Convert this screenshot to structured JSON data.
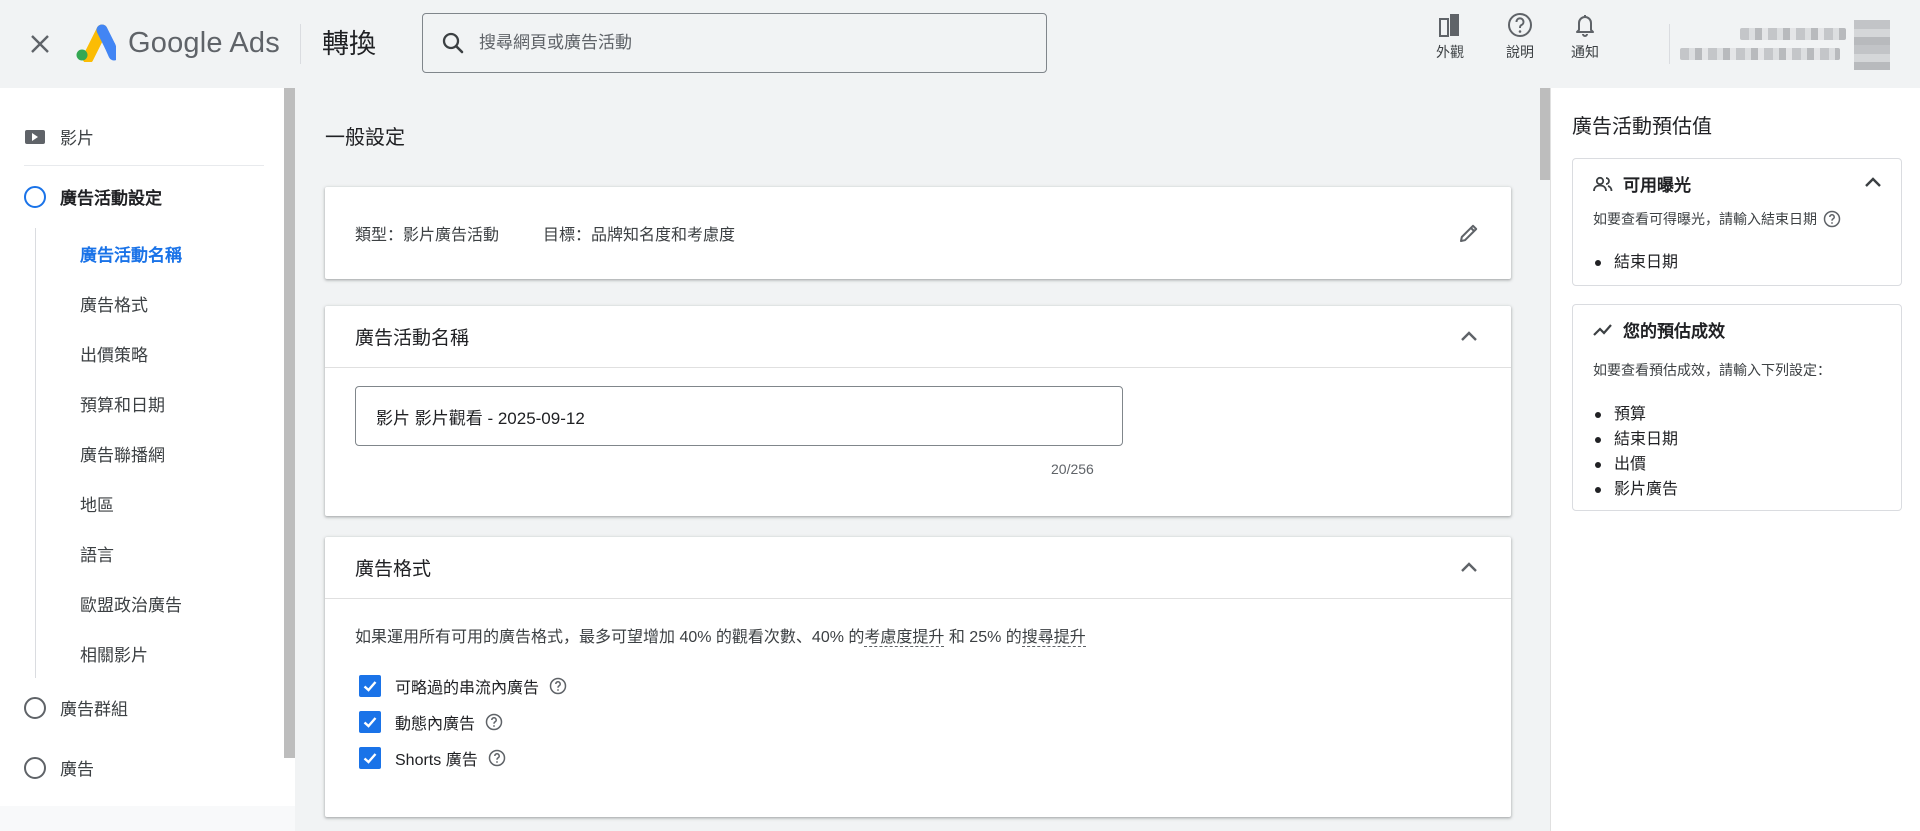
{
  "header": {
    "app_name": "Google Ads",
    "page_title": "轉換",
    "search_placeholder": "搜尋網頁或廣告活動",
    "tools": [
      {
        "label": "外觀",
        "icon": "appearance-icon"
      },
      {
        "label": "說明",
        "icon": "help-icon"
      },
      {
        "label": "通知",
        "icon": "bell-icon"
      }
    ]
  },
  "sidebar": {
    "video": "影片",
    "campaign_settings": "廣告活動設定",
    "sub_items": [
      "廣告活動名稱",
      "廣告格式",
      "出價策略",
      "預算和日期",
      "廣告聯播網",
      "地區",
      "語言",
      "歐盟政治廣告",
      "相關影片"
    ],
    "ad_groups": "廣告群組",
    "ads": "廣告"
  },
  "main": {
    "section_title": "一般設定",
    "type_label": "類型：影片廣告活動",
    "goal_label": "目標：品牌知名度和考慮度",
    "name_card": {
      "title": "廣告活動名稱",
      "value": "影片 影片觀看 - 2025-09-12",
      "counter": "20/256"
    },
    "format_card": {
      "title": "廣告格式",
      "desc_pre": "如果運用所有可用的廣告格式，最多可望增加 40% 的觀看次數、40% 的",
      "desc_link1": "考慮度提升",
      "desc_mid": " 和 25% 的",
      "desc_link2": "搜尋提升",
      "options": [
        "可略過的串流內廣告",
        "動態內廣告",
        "Shorts 廣告"
      ]
    }
  },
  "right_panel": {
    "title": "廣告活動預估值",
    "reach": {
      "title": "可用曝光",
      "desc": "如要查看可得曝光，請輸入結束日期",
      "items": [
        "結束日期"
      ]
    },
    "performance": {
      "title": "您的預估成效",
      "desc": "如要查看預估成效，請輸入下列設定：",
      "items": [
        "預算",
        "結束日期",
        "出價",
        "影片廣告"
      ]
    }
  },
  "colors": {
    "accent": "#1a73e8",
    "header_bg": "#f1f3f4",
    "text": "#202124"
  }
}
